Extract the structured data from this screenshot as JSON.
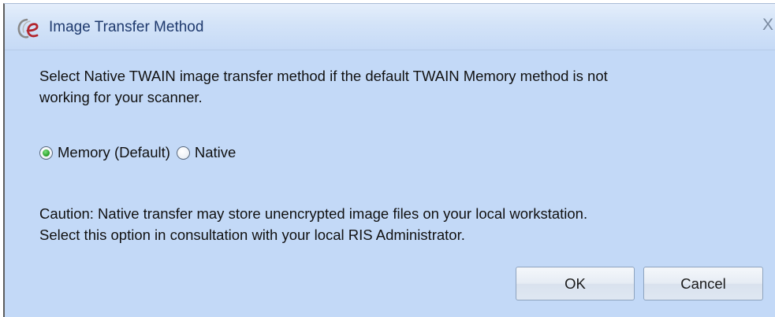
{
  "dialog": {
    "title": "Image Transfer Method",
    "close_glyph": "X",
    "app_icon": "ce-logo-icon"
  },
  "message": {
    "line1": "Select Native TWAIN image transfer method if the default TWAIN Memory method is not",
    "line2": "working for your scanner."
  },
  "options": [
    {
      "label": "Memory (Default)",
      "checked": true
    },
    {
      "label": "Native",
      "checked": false
    }
  ],
  "caution": {
    "line1": "Caution: Native transfer may store unencrypted image files on your local workstation.",
    "line2": "Select this option in consultation with your local RIS Administrator."
  },
  "buttons": {
    "ok_label": "OK",
    "cancel_label": "Cancel"
  },
  "colors": {
    "dialog_bg": "#c3d9f7",
    "title_text": "#1f3a6e",
    "logo_red": "#b3262e",
    "radio_selected": "#2fa52f"
  }
}
